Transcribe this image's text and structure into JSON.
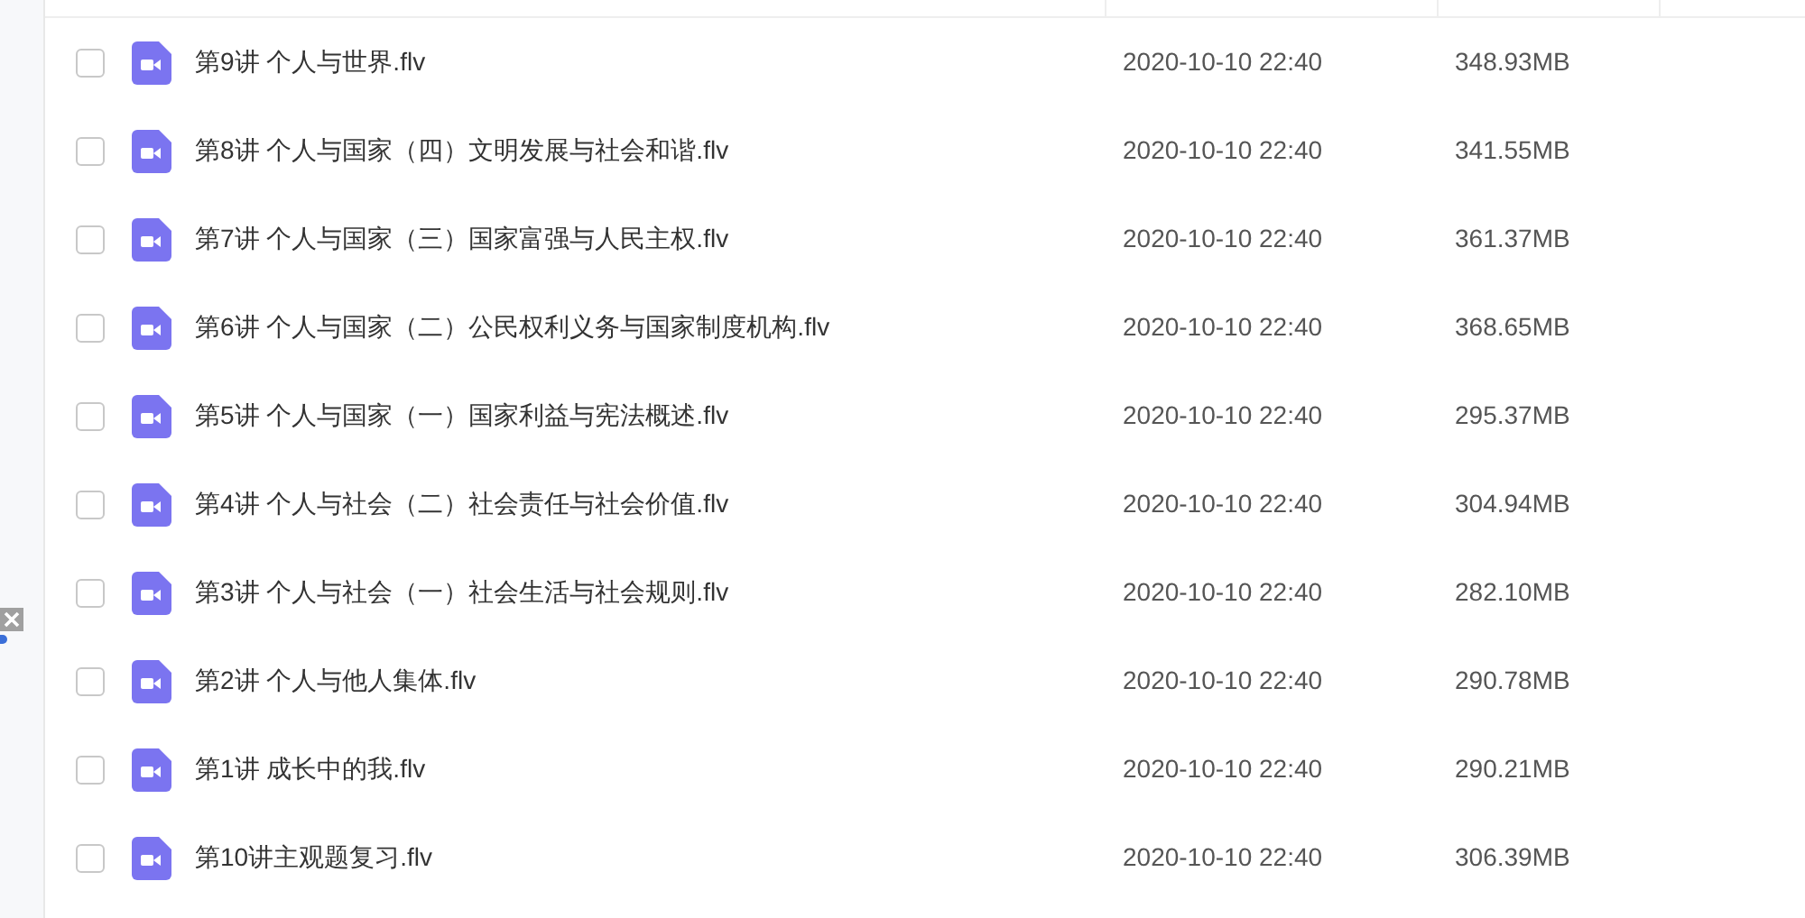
{
  "files": [
    {
      "name": "第9讲 个人与世界.flv",
      "date": "2020-10-10 22:40",
      "size": "348.93MB",
      "checked": false
    },
    {
      "name": "第8讲 个人与国家（四）文明发展与社会和谐.flv",
      "date": "2020-10-10 22:40",
      "size": "341.55MB",
      "checked": false
    },
    {
      "name": "第7讲 个人与国家（三）国家富强与人民主权.flv",
      "date": "2020-10-10 22:40",
      "size": "361.37MB",
      "checked": false
    },
    {
      "name": "第6讲 个人与国家（二）公民权利义务与国家制度机构.flv",
      "date": "2020-10-10 22:40",
      "size": "368.65MB",
      "checked": false
    },
    {
      "name": "第5讲 个人与国家（一）国家利益与宪法概述.flv",
      "date": "2020-10-10 22:40",
      "size": "295.37MB",
      "checked": false
    },
    {
      "name": "第4讲 个人与社会（二）社会责任与社会价值.flv",
      "date": "2020-10-10 22:40",
      "size": "304.94MB",
      "checked": false
    },
    {
      "name": "第3讲 个人与社会（一）社会生活与社会规则.flv",
      "date": "2020-10-10 22:40",
      "size": "282.10MB",
      "checked": false
    },
    {
      "name": "第2讲 个人与他人集体.flv",
      "date": "2020-10-10 22:40",
      "size": "290.78MB",
      "checked": false
    },
    {
      "name": "第1讲 成长中的我.flv",
      "date": "2020-10-10 22:40",
      "size": "290.21MB",
      "checked": false
    },
    {
      "name": "第10讲主观题复习.flv",
      "date": "2020-10-10 22:40",
      "size": "306.39MB",
      "checked": false
    }
  ]
}
